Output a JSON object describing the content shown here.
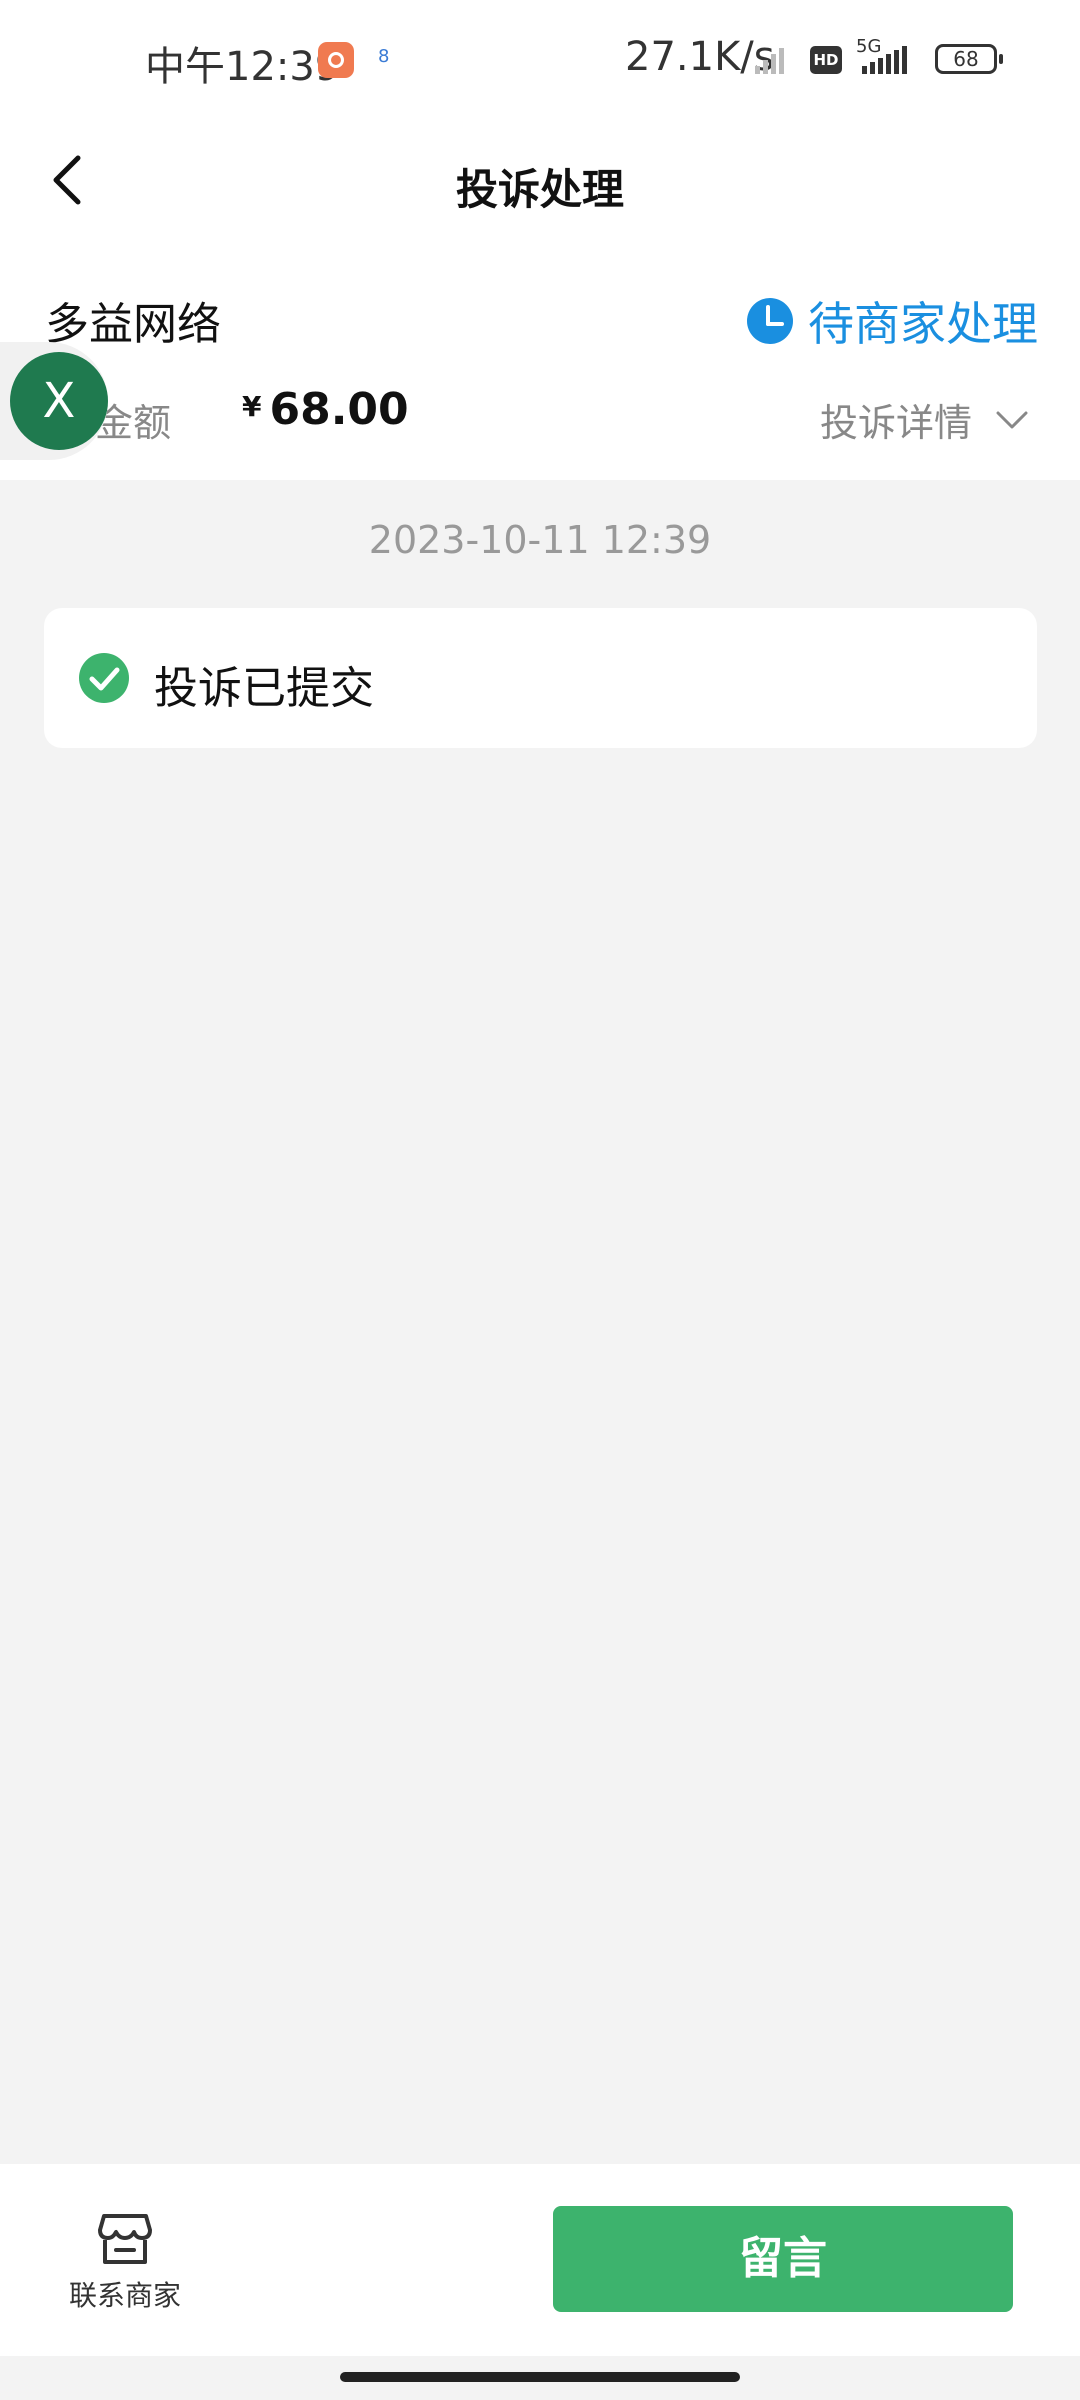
{
  "status_bar": {
    "time": "中午12:39",
    "mini_notice": "8",
    "net_speed": "27.1K/s",
    "hd_badge": "HD",
    "network": "5G",
    "battery": "68"
  },
  "nav": {
    "title": "投诉处理",
    "back_icon": "chevron-left-icon"
  },
  "complaint": {
    "merchant": "多益网络",
    "status": "待商家处理",
    "amount_label": "金额",
    "currency_symbol": "¥",
    "amount": "68.00",
    "detail_toggle": "投诉详情"
  },
  "floating_badge": {
    "letter": "X",
    "color": "#1f7a4f"
  },
  "timeline": {
    "timestamp": "2023-10-11 12:39",
    "event": "投诉已提交"
  },
  "bottom": {
    "contact_label": "联系商家",
    "message_button": "留言"
  },
  "colors": {
    "accent_green": "#3db36d",
    "status_blue": "#1a8fe0",
    "background": "#f3f3f3"
  }
}
